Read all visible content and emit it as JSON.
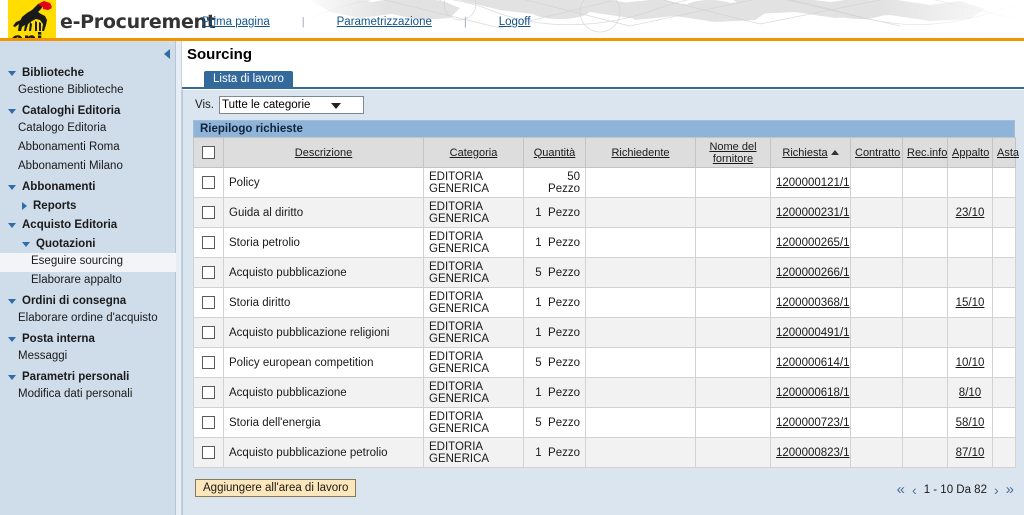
{
  "header": {
    "brand": "e-Procurement",
    "logo_text": "eni",
    "logo_alt": "eni-six-legged-dog-logo",
    "nav": [
      {
        "label": "Prima pagina"
      },
      {
        "label": "Parametrizzazione"
      },
      {
        "label": "Logoff"
      }
    ],
    "separator": "|"
  },
  "sidebar": {
    "collapse_icon": "chevron-left-icon",
    "items": [
      {
        "label": "Biblioteche",
        "type": "group",
        "state": "expanded",
        "level": 0
      },
      {
        "label": "Gestione Biblioteche",
        "type": "item",
        "level": 1
      },
      {
        "label": "Cataloghi Editoria",
        "type": "group",
        "state": "expanded",
        "level": 0
      },
      {
        "label": "Catalogo Editoria",
        "type": "item",
        "level": 1
      },
      {
        "label": "Abbonamenti Roma",
        "type": "item",
        "level": 1
      },
      {
        "label": "Abbonamenti Milano",
        "type": "item",
        "level": 1
      },
      {
        "label": "Abbonamenti",
        "type": "group",
        "state": "expanded",
        "level": 0
      },
      {
        "label": "Reports",
        "type": "group",
        "state": "collapsed",
        "level": 1
      },
      {
        "label": "Acquisto Editoria",
        "type": "group",
        "state": "expanded",
        "level": 0
      },
      {
        "label": "Quotazioni",
        "type": "group",
        "state": "expanded",
        "level": 1
      },
      {
        "label": "Eseguire sourcing",
        "type": "item",
        "level": 2,
        "selected": true
      },
      {
        "label": "Elaborare appalto",
        "type": "item",
        "level": 2
      },
      {
        "label": "Ordini di consegna",
        "type": "group",
        "state": "expanded",
        "level": 0
      },
      {
        "label": "Elaborare ordine d'acquisto",
        "type": "item",
        "level": 1
      },
      {
        "label": "Posta interna",
        "type": "group",
        "state": "expanded",
        "level": 0
      },
      {
        "label": "Messaggi",
        "type": "item",
        "level": 1
      },
      {
        "label": "Parametri personali",
        "type": "group",
        "state": "expanded",
        "level": 0
      },
      {
        "label": "Modifica dati personali",
        "type": "item",
        "level": 1
      }
    ]
  },
  "main": {
    "page_title": "Sourcing",
    "tab_label": "Lista di lavoro",
    "filter": {
      "label": "Vis.",
      "selected": "Tutte le categorie",
      "options": [
        "Tutte le categorie"
      ]
    },
    "table_title": "Riepilogo richieste",
    "columns": [
      {
        "key": "check",
        "label": "",
        "sortable": false
      },
      {
        "key": "desc",
        "label": "Descrizione",
        "sortable": true
      },
      {
        "key": "cat",
        "label": "Categoria",
        "sortable": true
      },
      {
        "key": "qty",
        "label": "Quantità",
        "sortable": true
      },
      {
        "key": "req",
        "label": "Richiedente",
        "sortable": true
      },
      {
        "key": "supplier",
        "label": "Nome del fornitore",
        "sortable": true
      },
      {
        "key": "request",
        "label": "Richiesta",
        "sortable": true,
        "sorted": "asc"
      },
      {
        "key": "contract",
        "label": "Contratto",
        "sortable": true
      },
      {
        "key": "recinfo",
        "label": "Rec.info",
        "sortable": true
      },
      {
        "key": "appalto",
        "label": "Appalto",
        "sortable": true
      },
      {
        "key": "asta",
        "label": "Asta",
        "sortable": true
      }
    ],
    "rows": [
      {
        "checked": false,
        "desc": "Policy",
        "cat": "EDITORIA GENERICA",
        "qty_num": "50",
        "qty_unit": "Pezzo",
        "qty_wrap": true,
        "req": "",
        "supplier": "",
        "request": "1200000121/1",
        "contract": "",
        "recinfo": "",
        "appalto": "",
        "asta": ""
      },
      {
        "checked": false,
        "desc": "Guida al diritto",
        "cat": "EDITORIA GENERICA",
        "qty_num": "1",
        "qty_unit": "Pezzo",
        "qty_wrap": false,
        "req": "",
        "supplier": "",
        "request": "1200000231/1",
        "contract": "",
        "recinfo": "",
        "appalto": "23/10",
        "asta": ""
      },
      {
        "checked": false,
        "desc": "Storia petrolio",
        "cat": "EDITORIA GENERICA",
        "qty_num": "1",
        "qty_unit": "Pezzo",
        "qty_wrap": false,
        "req": "",
        "supplier": "",
        "request": "1200000265/1",
        "contract": "",
        "recinfo": "",
        "appalto": "",
        "asta": ""
      },
      {
        "checked": false,
        "desc": "Acquisto pubblicazione",
        "cat": "EDITORIA GENERICA",
        "qty_num": "5",
        "qty_unit": "Pezzo",
        "qty_wrap": false,
        "req": "",
        "supplier": "",
        "request": "1200000266/1",
        "contract": "",
        "recinfo": "",
        "appalto": "",
        "asta": ""
      },
      {
        "checked": false,
        "desc": "Storia diritto",
        "cat": "EDITORIA GENERICA",
        "qty_num": "1",
        "qty_unit": "Pezzo",
        "qty_wrap": false,
        "req": "",
        "supplier": "",
        "request": "1200000368/1",
        "contract": "",
        "recinfo": "",
        "appalto": "15/10",
        "asta": ""
      },
      {
        "checked": false,
        "desc": "Acquisto pubblicazione religioni",
        "cat": "EDITORIA GENERICA",
        "qty_num": "1",
        "qty_unit": "Pezzo",
        "qty_wrap": false,
        "req": "",
        "supplier": "",
        "request": "1200000491/1",
        "contract": "",
        "recinfo": "",
        "appalto": "",
        "asta": ""
      },
      {
        "checked": false,
        "desc": "Policy   european competition",
        "cat": "EDITORIA GENERICA",
        "qty_num": "5",
        "qty_unit": "Pezzo",
        "qty_wrap": false,
        "req": "",
        "supplier": "",
        "request": "1200000614/1",
        "contract": "",
        "recinfo": "",
        "appalto": "10/10",
        "asta": ""
      },
      {
        "checked": false,
        "desc": "Acquisto pubblicazione",
        "cat": "EDITORIA GENERICA",
        "qty_num": "1",
        "qty_unit": "Pezzo",
        "qty_wrap": false,
        "req": "",
        "supplier": "",
        "request": "1200000618/1",
        "contract": "",
        "recinfo": "",
        "appalto": "8/10",
        "asta": ""
      },
      {
        "checked": false,
        "desc": "Storia dell'energia",
        "cat": "EDITORIA GENERICA",
        "qty_num": "5",
        "qty_unit": "Pezzo",
        "qty_wrap": false,
        "req": "",
        "supplier": "",
        "request": "1200000723/1",
        "contract": "",
        "recinfo": "",
        "appalto": "58/10",
        "asta": ""
      },
      {
        "checked": false,
        "desc": "Acquisto pubblicazione petrolio",
        "cat": "EDITORIA GENERICA",
        "qty_num": "1",
        "qty_unit": "Pezzo",
        "qty_wrap": false,
        "req": "",
        "supplier": "",
        "request": "1200000823/1",
        "contract": "",
        "recinfo": "",
        "appalto": "87/10",
        "asta": ""
      }
    ],
    "footer_button": "Aggiungere all'area di lavoro",
    "pagination": {
      "first_icon": "«",
      "prev_icon": "‹",
      "range": "1 - 10 Da 82",
      "next_icon": "›",
      "last_icon": "»"
    }
  },
  "colors": {
    "brand_orange": "#f29400",
    "logo_yellow": "#ffdd00",
    "tab_blue": "#34699c",
    "panel_blue": "#dbe5f0",
    "sidebar_blue": "#cfdcea",
    "table_title_blue": "#8fb4d9",
    "link_blue": "#14548c",
    "button_tan": "#fce6bb"
  }
}
